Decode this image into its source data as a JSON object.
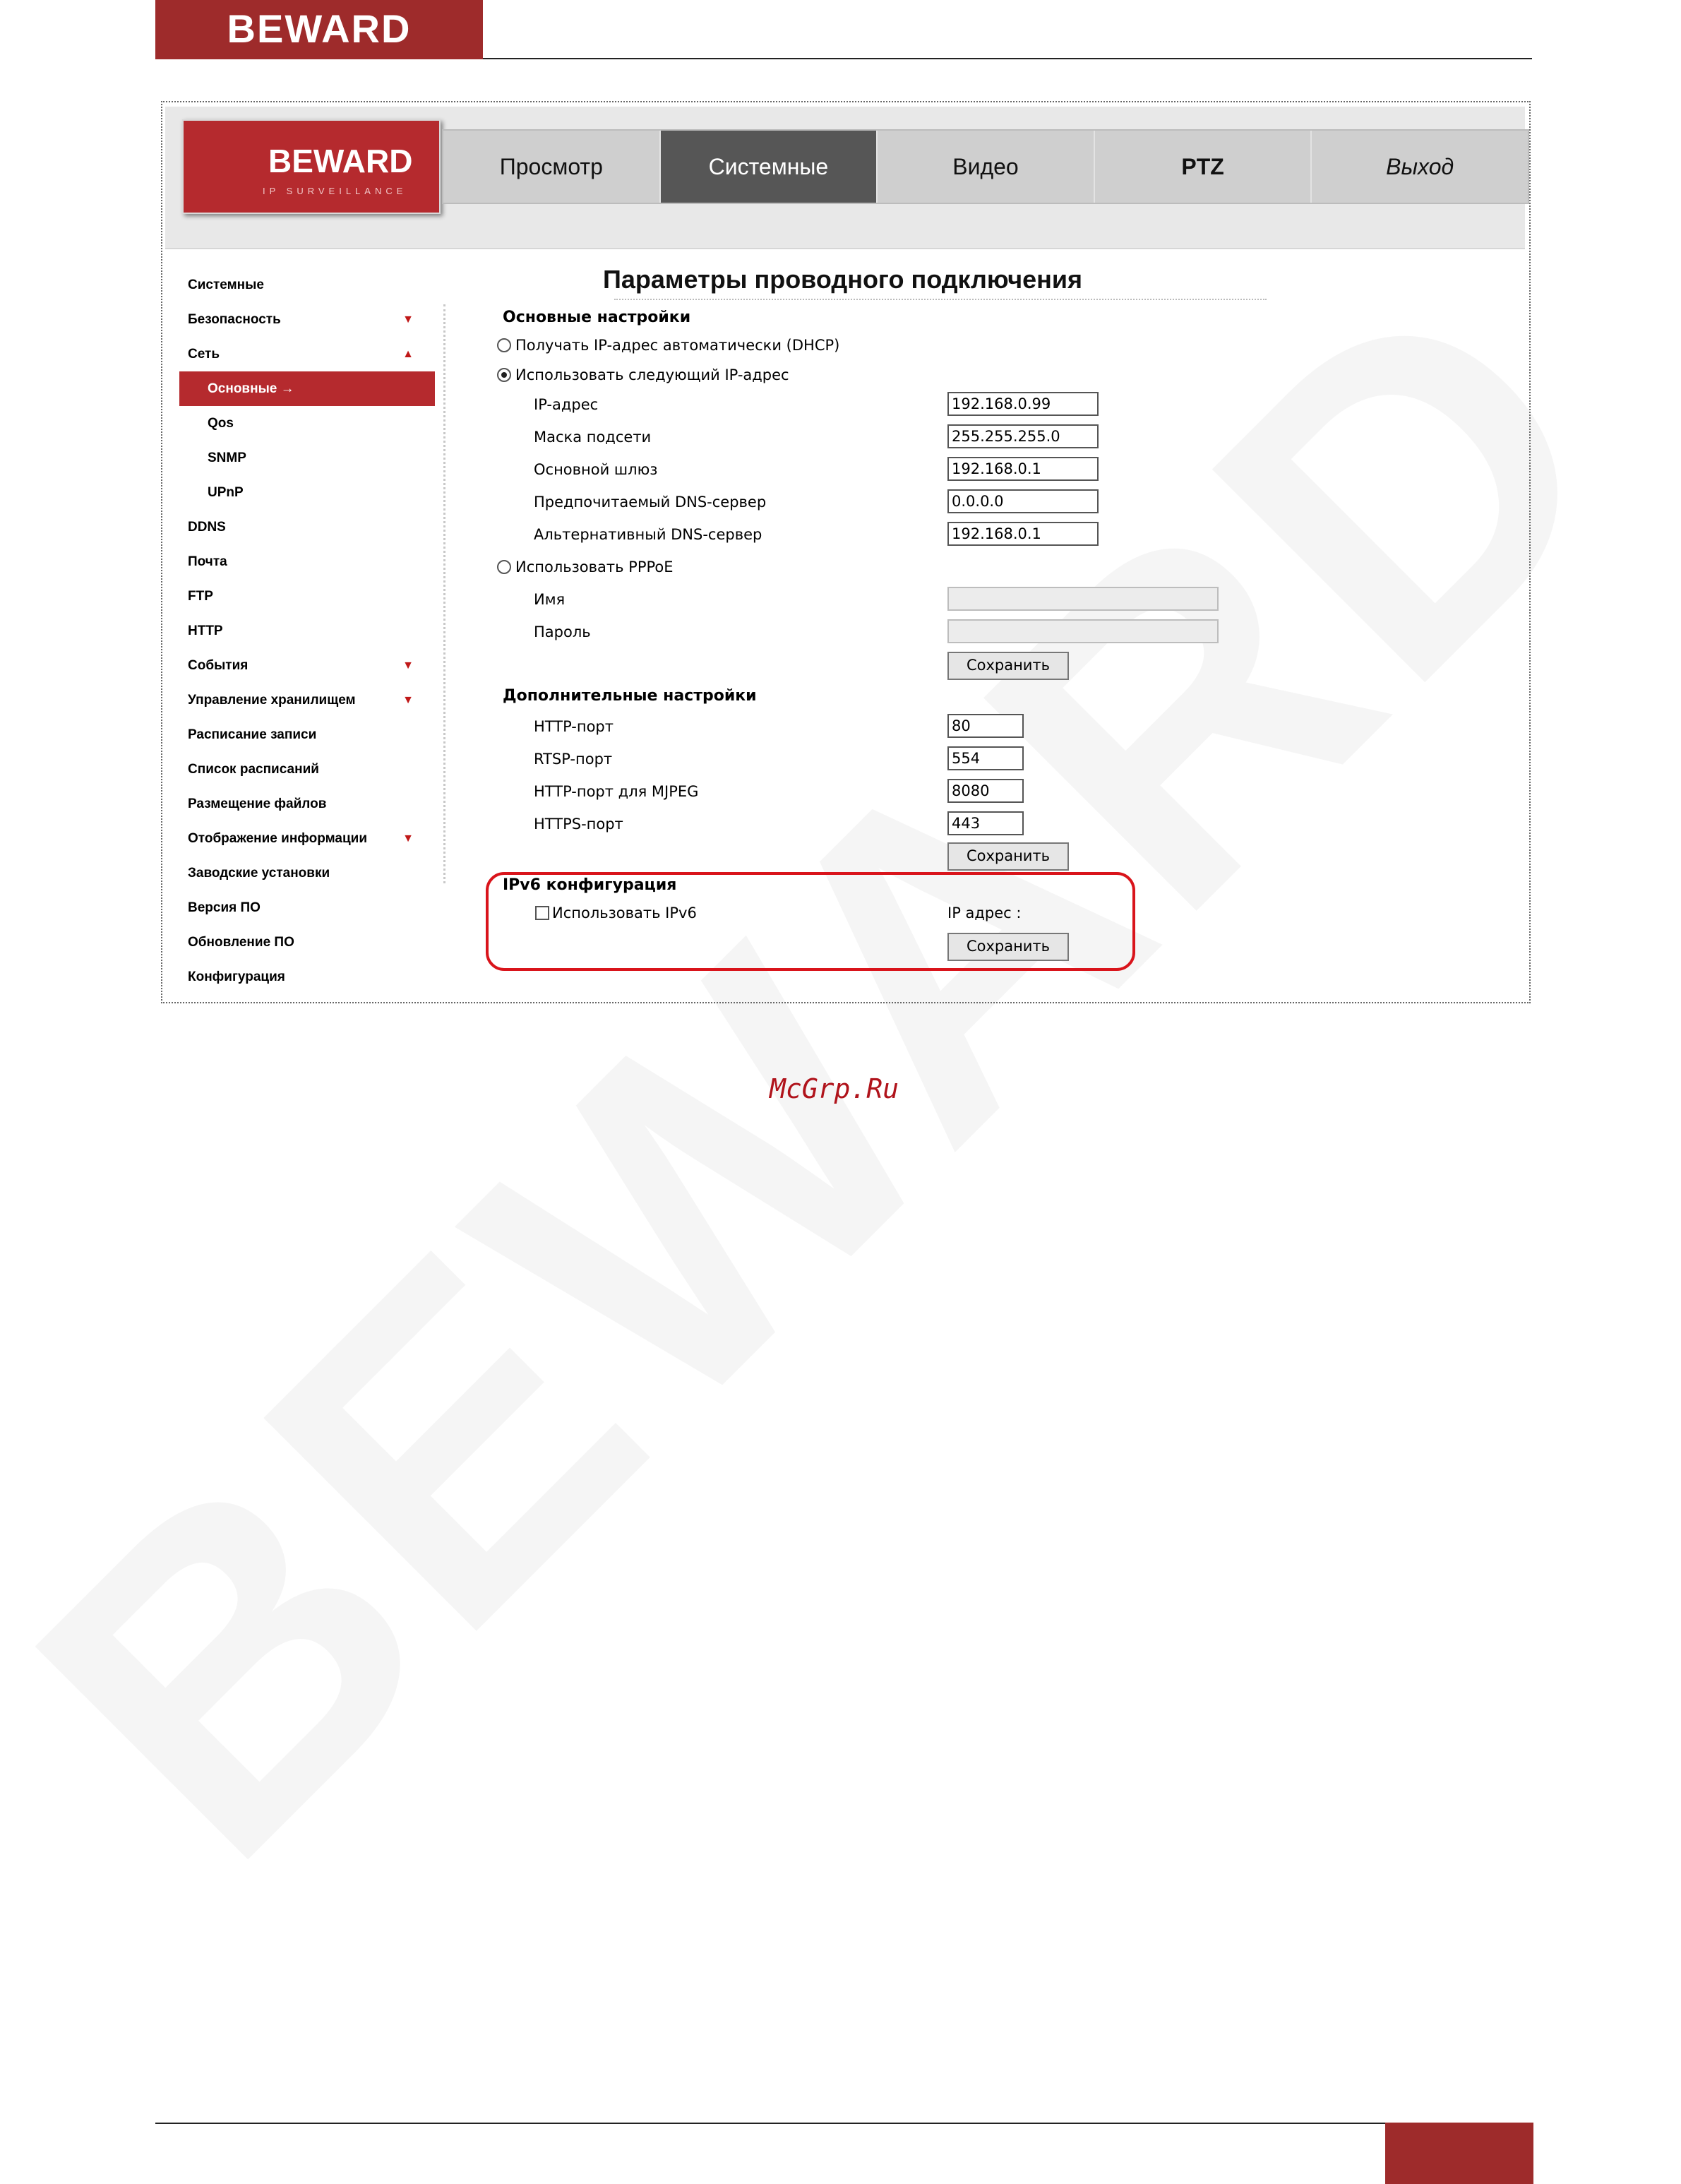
{
  "doc_header": {
    "logo": "BEWARD"
  },
  "camera_ui": {
    "logo": {
      "brand": "BEWARD",
      "tagline": "IP SURVEILLANCE"
    },
    "tabs": [
      {
        "label": "Просмотр",
        "active": false
      },
      {
        "label": "Системные",
        "active": true
      },
      {
        "label": "Видео",
        "active": false
      },
      {
        "label": "PTZ",
        "active": false
      },
      {
        "label": "Выход",
        "active": false
      }
    ],
    "nav": [
      {
        "label": "Системные",
        "arrow": ""
      },
      {
        "label": "Безопасность",
        "arrow": "▼"
      },
      {
        "label": "Сеть",
        "arrow": "▲"
      },
      {
        "label": "Основные →",
        "arrow": "",
        "active": true,
        "sub": true
      },
      {
        "label": "Qos",
        "arrow": "",
        "sub": true
      },
      {
        "label": "SNMP",
        "arrow": "",
        "sub": true
      },
      {
        "label": "UPnP",
        "arrow": "",
        "sub": true
      },
      {
        "label": "DDNS",
        "arrow": ""
      },
      {
        "label": "Почта",
        "arrow": ""
      },
      {
        "label": "FTP",
        "arrow": ""
      },
      {
        "label": "HTTP",
        "arrow": ""
      },
      {
        "label": "События",
        "arrow": "▼"
      },
      {
        "label": "Управление хранилищем",
        "arrow": "▼"
      },
      {
        "label": "Расписание записи",
        "arrow": ""
      },
      {
        "label": "Список расписаний",
        "arrow": ""
      },
      {
        "label": "Размещение файлов",
        "arrow": ""
      },
      {
        "label": "Отображение информации",
        "arrow": "▼"
      },
      {
        "label": "Заводские установки",
        "arrow": ""
      },
      {
        "label": "Версия ПО",
        "arrow": ""
      },
      {
        "label": "Обновление ПО",
        "arrow": ""
      },
      {
        "label": "Конфигурация",
        "arrow": ""
      }
    ],
    "main": {
      "title": "Параметры проводного подключения",
      "basic": {
        "heading": "Основные настройки",
        "dhcp_label": "Получать IP-адрес автоматически (DHCP)",
        "static_label": "Использовать следующий IP-адрес",
        "fields": {
          "ip_label": "IP-адрес",
          "ip": "192.168.0.99",
          "mask_label": "Маска подсети",
          "mask": "255.255.255.0",
          "gw_label": "Основной шлюз",
          "gw": "192.168.0.1",
          "dns1_label": "Предпочитаемый DNS-сервер",
          "dns1": "0.0.0.0",
          "dns2_label": "Альтернативный DNS-сервер",
          "dns2": "192.168.0.1"
        },
        "pppoe_label": "Использовать PPPoE",
        "name_label": "Имя",
        "password_label": "Пароль",
        "save": "Сохранить"
      },
      "advanced": {
        "heading": "Дополнительные настройки",
        "http_label": "HTTP-порт",
        "http": "80",
        "rtsp_label": "RTSP-порт",
        "rtsp": "554",
        "mjpeg_label": "HTTP-порт для MJPEG",
        "mjpeg": "8080",
        "https_label": "HTTPS-порт",
        "https": "443",
        "save": "Сохранить"
      },
      "ipv6": {
        "heading": "IPv6 конфигурация",
        "use_label": "Использовать IPv6",
        "ip_label": "IP адрес :",
        "save": "Сохранить"
      }
    }
  },
  "watermark_site": "McGrp.Ru",
  "colors": {
    "brand_red": "#b52a2e",
    "highlight_red": "#d9141b",
    "active_tab": "#565656"
  }
}
